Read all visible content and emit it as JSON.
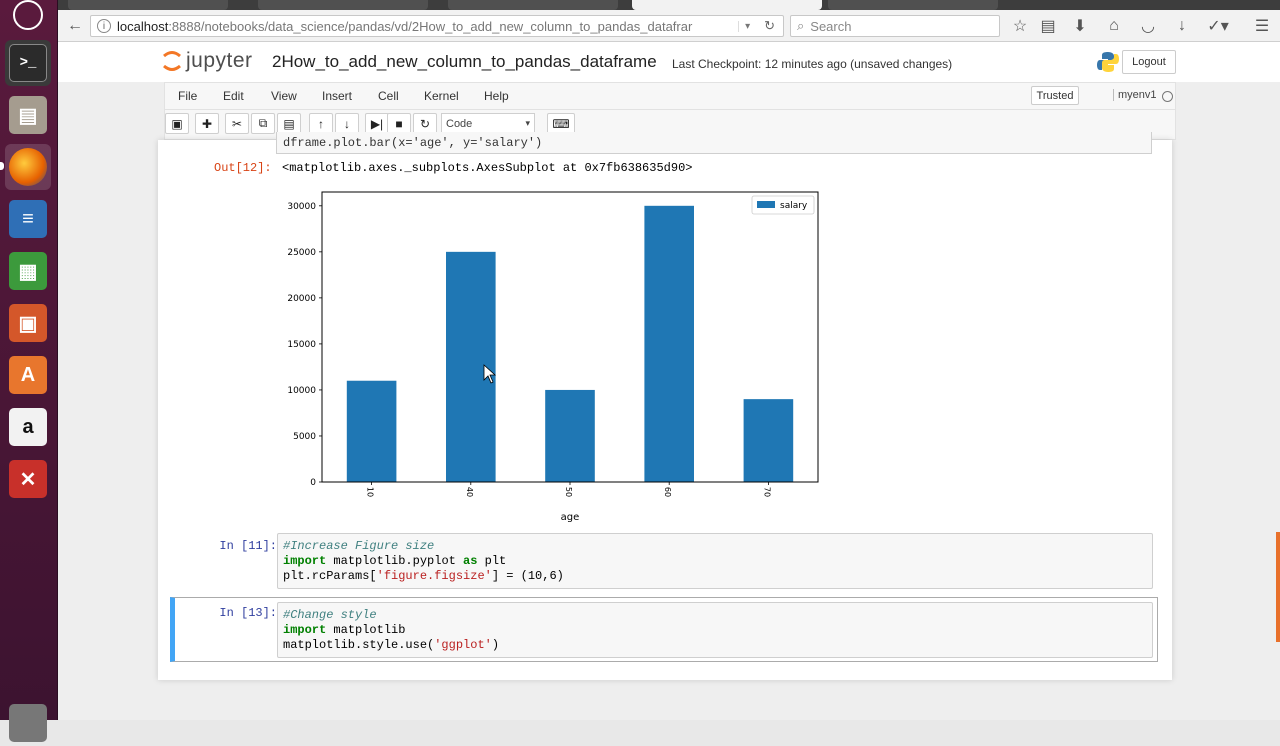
{
  "browser": {
    "url_host": "localhost",
    "url_path": ":8888/notebooks/data_science/pandas/vd/2How_to_add_new_column_to_pandas_datafrar",
    "search_placeholder": "Search"
  },
  "jupyter": {
    "logo_text": "jupyter",
    "notebook_title": "2How_to_add_new_column_to_pandas_dataframe",
    "checkpoint": "Last Checkpoint: 12 minutes ago (unsaved changes)",
    "logout_label": "Logout",
    "menu": [
      "File",
      "Edit",
      "View",
      "Insert",
      "Cell",
      "Kernel",
      "Help"
    ],
    "trusted_label": "Trusted",
    "kernel_name": "myenv1",
    "cell_type": "Code"
  },
  "cells": {
    "prev_code": "dframe.plot.bar(x='age', y='salary')",
    "out_prompt": "Out[12]:",
    "out_text": "<matplotlib.axes._subplots.AxesSubplot at 0x7fb638635d90>",
    "cell11_prompt": "In [11]:",
    "cell11_line1": "#Increase Figure size",
    "cell11_line2_kw1": "import",
    "cell11_line2_mid": " matplotlib.pyplot ",
    "cell11_line2_kw2": "as",
    "cell11_line2_end": " plt",
    "cell11_line3_a": "plt.rcParams[",
    "cell11_line3_str": "'figure.figsize'",
    "cell11_line3_b": "] = (10,6)",
    "cell13_prompt": "In [13]:",
    "cell13_line1": "#Change style",
    "cell13_line2_kw": "import",
    "cell13_line2_end": " matplotlib",
    "cell13_line3_a": "matplotlib.style.use(",
    "cell13_line3_str": "'ggplot'",
    "cell13_line3_b": ")"
  },
  "chart_data": {
    "type": "bar",
    "categories": [
      "10",
      "40",
      "50",
      "60",
      "70"
    ],
    "series": [
      {
        "name": "salary",
        "values": [
          11000,
          25000,
          10000,
          30000,
          9000
        ]
      }
    ],
    "xlabel": "age",
    "ylabel": "",
    "ylim": [
      0,
      31500
    ],
    "yticks": [
      0,
      5000,
      10000,
      15000,
      20000,
      25000,
      30000
    ],
    "legend": "top-right",
    "bar_color": "#1f77b4"
  },
  "colors": {
    "accent_blue": "#42a5f5",
    "prompt_in": "#303f9f",
    "prompt_out": "#d84315"
  }
}
